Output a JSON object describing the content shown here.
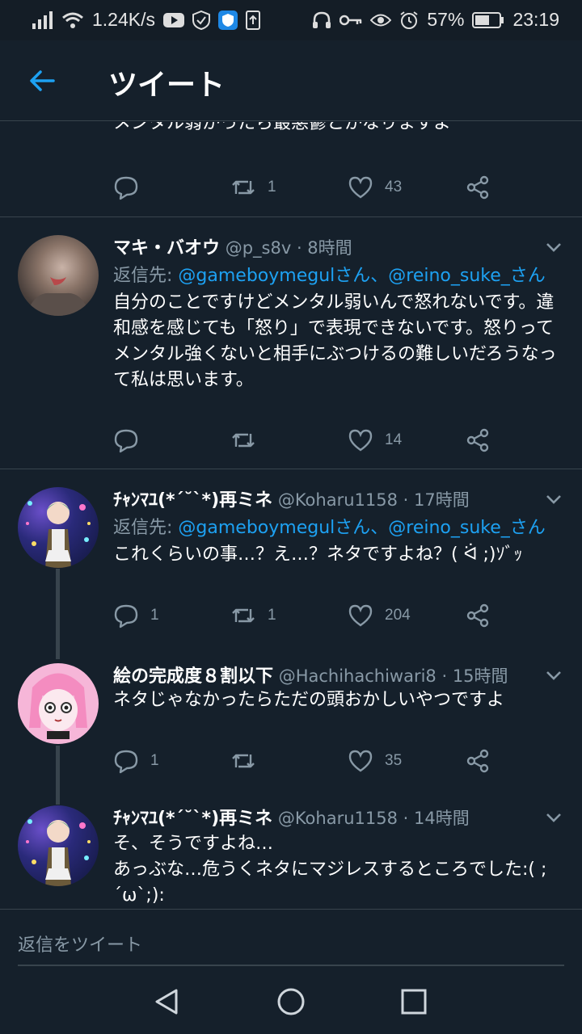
{
  "status_bar": {
    "speed": "1.24K/s",
    "battery": "57%",
    "time": "23:19"
  },
  "header": {
    "title": "ツイート"
  },
  "top_tweet": {
    "partial_text": "メンタル弱かったら最悪鬱とかなりますよ",
    "retweets": "1",
    "likes": "43"
  },
  "tweets": [
    {
      "name": "マキ・バオウ",
      "handle": "@p_s8v",
      "time": " · 8時間",
      "replying_label": "返信先: ",
      "mention1": "@gameboymegulさん",
      "sep": "、",
      "mention2": "@reino_suke_さん",
      "body": "自分のことですけどメンタル弱いんで怒れないです。違和感を感じても「怒り」で表現できないです。怒りってメンタル強くないと相手にぶつけるの難しいだろうなって私は思います。",
      "replies": "",
      "retweets": "",
      "likes": "14"
    },
    {
      "name": "ﾁｬﾝﾏﾕ(*´˘`*)再ミネ",
      "handle": "@Koharu1158",
      "time": " · 17時間",
      "replying_label": "返信先: ",
      "mention1": "@gameboymegulさん",
      "sep": "、",
      "mention2": "@reino_suke_さん",
      "body": "これくらいの事…？え…？ネタですよね？( ᐛ ;)ｿﾞｯ",
      "replies": "1",
      "retweets": "1",
      "likes": "204"
    },
    {
      "name": "絵の完成度８割以下",
      "handle": "@Hachihachiwari8",
      "time": " · 15時間",
      "body": "ネタじゃなかったらただの頭おかしいやつですよ",
      "replies": "1",
      "retweets": "",
      "likes": "35"
    },
    {
      "name": "ﾁｬﾝﾏﾕ(*´˘`*)再ミネ",
      "handle": "@Koharu1158",
      "time": " · 14時間",
      "body_line1": "そ、そうですよね…",
      "body_line2": "あっぶな…危うくネタにマジレスするところでした:( ;´ω`;):"
    }
  ],
  "reply_box": {
    "placeholder": "返信をツイート"
  },
  "colors": {
    "background": "#15202b",
    "accent": "#1da1f2",
    "secondary_text": "#8899a6",
    "divider": "#38444d"
  }
}
